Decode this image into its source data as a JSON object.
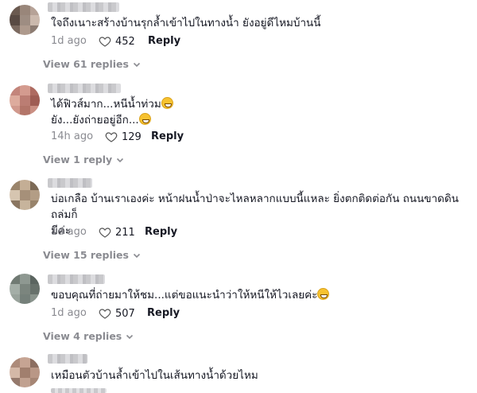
{
  "comments": [
    {
      "text_lines": [
        "ใจถึงเนาะสร้างบ้านรุกล้ำเข้าไปในทางน้ำ ยังอยู่ดีไหมบ้านนี้"
      ],
      "date": "1d ago",
      "likes": "452",
      "reply_label": "Reply",
      "view_replies": "View 61 replies",
      "avatar_colors": [
        "#6d5a4f",
        "#9b8678",
        "#b8a295",
        "#5a4a42",
        "#a08d80",
        "#cdb9ab",
        "#7e6a5e",
        "#b09a8b",
        "#8f7c70"
      ]
    },
    {
      "text_lines": [
        "ได้ฟิวส์มาก...หนีน้ำท่วม",
        "ยัง...ยังถ่ายอยู่อีก..."
      ],
      "emoji_lines": [
        true,
        true
      ],
      "date": "14h ago",
      "likes": "129",
      "reply_label": "Reply",
      "view_replies": "View 1 reply",
      "avatar_colors": [
        "#c98478",
        "#d99a8c",
        "#b46a5e",
        "#e2aa9a",
        "#c07c70",
        "#a55c52",
        "#d6988a",
        "#b87466",
        "#cf8e80"
      ]
    },
    {
      "text_lines": [
        "บ่อเกลือ บ้านเราเองค่ะ หน้าฝนน้ำป่าจะไหลหลากแบบนี้แหละ ยิ่งตกติดต่อกัน ถนนขาดดินถล่มก็",
        "มีค่ะ"
      ],
      "date": "1d ago",
      "likes": "211",
      "reply_label": "Reply",
      "view_replies": "View 15 replies",
      "avatar_colors": [
        "#9c8468",
        "#c6ae92",
        "#7e6a54",
        "#d8c5ad",
        "#a89076",
        "#b59d82",
        "#8c765e",
        "#c9b499",
        "#9a8368"
      ]
    },
    {
      "text_lines": [
        "ขอบคุณที่ถ่ายมาให้ชม...แต่ขอแนะนำว่าให้หนีให้ไวเลยค่ะ"
      ],
      "emoji_lines": [
        true
      ],
      "date": "1d ago",
      "likes": "507",
      "reply_label": "Reply",
      "view_replies": "View 4 replies",
      "avatar_colors": [
        "#6f7a73",
        "#8d9890",
        "#5a6560",
        "#a3aea6",
        "#7a857e",
        "#66716b",
        "#98a39b",
        "#74807a",
        "#88938c"
      ]
    },
    {
      "text_lines": [
        "เหมือนตัวบ้านล้ำเข้าไปในเส้นทางน้ำด้วยไหม"
      ],
      "date": "",
      "likes": "",
      "reply_label": "",
      "view_replies": "",
      "avatar_colors": [
        "#b08a78",
        "#c9a390",
        "#8f6d5e",
        "#d7b7a5",
        "#a47e6c",
        "#bc9684",
        "#98786a",
        "#c4a08e",
        "#a98573"
      ]
    }
  ],
  "icons": {
    "like": "heart-outline-icon",
    "expand": "chevron-down-icon"
  }
}
